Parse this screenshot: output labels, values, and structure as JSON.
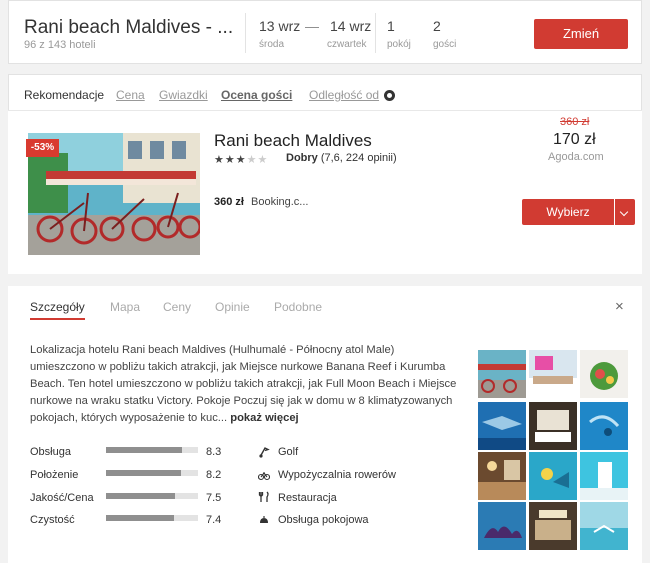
{
  "search": {
    "title": "Rani beach Maldives - ...",
    "count": "96 z 143 hoteli",
    "checkin_date": "13 wrz",
    "checkin_day": "środa",
    "dash": "—",
    "checkout_date": "14 wrz",
    "checkout_day": "czwartek",
    "rooms_value": "1",
    "rooms_label": "pokój",
    "guests_value": "2",
    "guests_label": "gości",
    "change_label": "Zmień"
  },
  "sort": {
    "recommended": "Rekomendacje",
    "price": "Cena",
    "stars": "Gwiazdki",
    "rating": "Ocena gości",
    "distance": "Odległość od"
  },
  "card": {
    "name": "Rani beach Maldives",
    "discount": "-53%",
    "star_count": 3,
    "star_max": 5,
    "rating_word": "Dobry",
    "rating_detail": "(7,6, 224 opinii)",
    "alt_price": "360 zł",
    "alt_provider": "Booking.c...",
    "old_price": "360 zł",
    "price": "170 zł",
    "provider": "Agoda.com",
    "choose_label": "Wybierz"
  },
  "details": {
    "tabs": [
      "Szczegóły",
      "Mapa",
      "Ceny",
      "Opinie",
      "Podobne"
    ],
    "close": "×",
    "description": "Lokalizacja hotelu Rani beach Maldives (Hulhumalé - Północny atol Male) umieszczono w pobliżu takich atrakcji, jak Miejsce nurkowe Banana Reef i Kurumba Beach. Ten hotel umieszczono w pobliżu takich atrakcji, jak Full Moon Beach i Miejsce nurkowe na wraku statku Victory. Pokoje Poczuj się jak w domu w 8 klimatyzowanych pokojach, których wyposażenie to kuc...",
    "more": "pokaż więcej",
    "scores": [
      {
        "label": "Obsługa",
        "value": "8.3",
        "fraction": 0.83
      },
      {
        "label": "Położenie",
        "value": "8.2",
        "fraction": 0.82
      },
      {
        "label": "Jakość/Cena",
        "value": "7.5",
        "fraction": 0.75
      },
      {
        "label": "Czystość",
        "value": "7.4",
        "fraction": 0.74
      }
    ],
    "amenities": [
      {
        "label": "Golf",
        "icon": "golf-icon"
      },
      {
        "label": "Wypożyczalnia rowerów",
        "icon": "bicycle-icon"
      },
      {
        "label": "Restauracja",
        "icon": "restaurant-icon"
      },
      {
        "label": "Obsługa pokojowa",
        "icon": "room-service-icon"
      }
    ]
  },
  "colors": {
    "accent": "#d13b32",
    "score_bar": "#8f8f8f"
  }
}
